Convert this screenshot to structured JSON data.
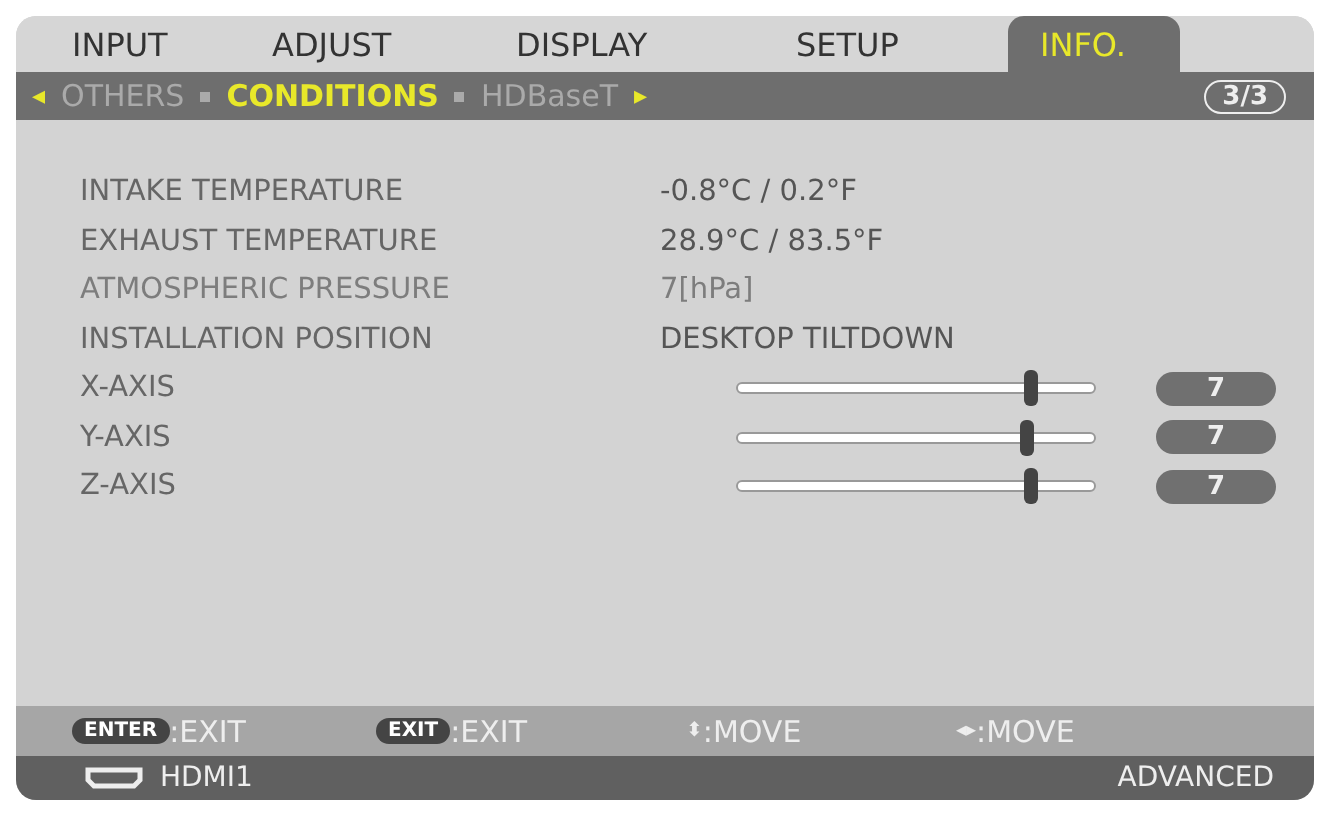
{
  "tabs": [
    {
      "label": "INPUT",
      "selected": false
    },
    {
      "label": "ADJUST",
      "selected": false
    },
    {
      "label": "DISPLAY",
      "selected": false
    },
    {
      "label": "SETUP",
      "selected": false
    },
    {
      "label": "INFO.",
      "selected": true
    }
  ],
  "subtabs": {
    "prev": "◂",
    "next": "▸",
    "page": "3/3",
    "items": [
      {
        "label": "OTHERS",
        "selected": false
      },
      {
        "label": "CONDITIONS",
        "selected": true
      },
      {
        "label": "HDBaseT",
        "selected": false
      }
    ]
  },
  "rows": [
    {
      "kind": "text",
      "label": "INTAKE TEMPERATURE",
      "value": "-0.8°C / 0.2°F",
      "disabled": false
    },
    {
      "kind": "text",
      "label": "EXHAUST TEMPERATURE",
      "value": "28.9°C / 83.5°F",
      "disabled": false
    },
    {
      "kind": "text",
      "label": "ATMOSPHERIC PRESSURE",
      "value": "7[hPa]",
      "disabled": true
    },
    {
      "kind": "text",
      "label": "INSTALLATION POSITION",
      "value": "DESKTOP TILTDOWN",
      "disabled": false
    },
    {
      "kind": "slider",
      "label": "X-AXIS",
      "level": 0.82,
      "value": "7",
      "disabled": false
    },
    {
      "kind": "slider",
      "label": "Y-AXIS",
      "level": 0.81,
      "value": "7",
      "disabled": false
    },
    {
      "kind": "slider",
      "label": "Z-AXIS",
      "level": 0.82,
      "value": "7",
      "disabled": false
    }
  ],
  "hints": [
    {
      "kind": "badge",
      "key": "ENTER",
      "label": ":EXIT"
    },
    {
      "kind": "badge",
      "key": "EXIT",
      "label": ":EXIT"
    },
    {
      "kind": "glyph",
      "key": "⬍",
      "label": ":MOVE"
    },
    {
      "kind": "glyph",
      "key": "◂▸",
      "label": ":MOVE"
    }
  ],
  "status_bar": {
    "source": "HDMI1",
    "mode": "ADVANCED"
  }
}
